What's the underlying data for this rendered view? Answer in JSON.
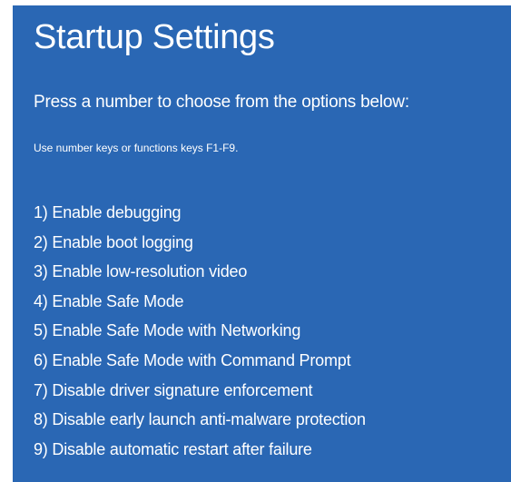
{
  "title": "Startup Settings",
  "prompt": "Press a number to choose from the options below:",
  "hint": "Use number keys or functions keys F1-F9.",
  "options": [
    "1) Enable debugging",
    "2) Enable boot logging",
    "3) Enable low-resolution video",
    "4) Enable Safe Mode",
    "5) Enable Safe Mode with Networking",
    "6) Enable Safe Mode with Command Prompt",
    "7) Disable driver signature enforcement",
    "8) Disable early launch anti-malware protection",
    "9) Disable automatic restart after failure"
  ],
  "colors": {
    "background": "#2a67b4",
    "text": "#ffffff"
  }
}
